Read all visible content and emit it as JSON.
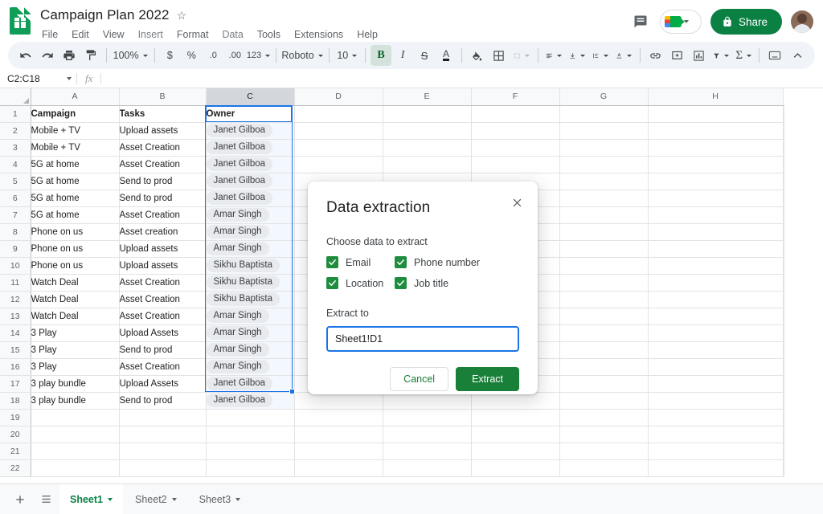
{
  "app": {
    "logo_icon": "sheets-logo-icon",
    "doc_title": "Campaign Plan 2022",
    "star_icon": "☆",
    "menus": [
      "File",
      "Edit",
      "View",
      "Insert",
      "Format",
      "Data",
      "Tools",
      "Extensions",
      "Help"
    ],
    "comment_icon": "comment-icon",
    "meet_icon": "meet-camera-icon",
    "share_label": "Share",
    "share_lock_icon": "lock-icon",
    "avatar_icon": "user-avatar",
    "accent_green": "#0b8043",
    "accent_blue": "#1a73e8"
  },
  "toolbar": {
    "undo": "undo-icon",
    "redo": "redo-icon",
    "print": "print-icon",
    "paint": "paint-format-icon",
    "zoom_value": "100%",
    "currency": "$",
    "percent": "%",
    "decimal_decrease": ".0",
    "decimal_increase": ".00",
    "number_format": "123",
    "font_name": "Roboto",
    "font_size": "10",
    "bold": "B",
    "italic": "I",
    "strikethrough": "S",
    "text_color": "A",
    "fill_color": "fill-color-icon",
    "borders": "borders-icon",
    "merge_cells": "merge-cells-icon",
    "align_horizontal": "align-left-icon",
    "align_vertical": "align-bottom-icon",
    "text_wrap": "text-wrap-icon",
    "text_rotation": "text-rotation-icon",
    "insert_link": "link-icon",
    "insert_comment": "comment-plus-icon",
    "insert_chart": "chart-icon",
    "filter": "filter-icon",
    "functions": "sigma-icon",
    "input_tools": "input-tools-icon",
    "collapse": "collapse-chevron-icon"
  },
  "formula_bar": {
    "name_box": "C2:C18",
    "fx_label": "fx",
    "formula_value": ""
  },
  "grid": {
    "columns": [
      "A",
      "B",
      "C",
      "D",
      "E",
      "F",
      "G",
      "H"
    ],
    "selected_column": "C",
    "header_row": [
      "Campaign",
      "Tasks",
      "Owner"
    ],
    "rows": [
      {
        "n": 2,
        "campaign": "Mobile + TV",
        "task": "Upload assets",
        "owner": "Janet Gilboa"
      },
      {
        "n": 3,
        "campaign": "Mobile + TV",
        "task": "Asset Creation",
        "owner": "Janet Gilboa"
      },
      {
        "n": 4,
        "campaign": "5G at home",
        "task": "Asset Creation",
        "owner": "Janet Gilboa"
      },
      {
        "n": 5,
        "campaign": "5G at home",
        "task": "Send to prod",
        "owner": "Janet Gilboa"
      },
      {
        "n": 6,
        "campaign": "5G at home",
        "task": "Send to prod",
        "owner": "Janet Gilboa"
      },
      {
        "n": 7,
        "campaign": "5G at home",
        "task": "Asset Creation",
        "owner": "Amar Singh"
      },
      {
        "n": 8,
        "campaign": "Phone on us",
        "task": "Asset creation",
        "owner": "Amar Singh"
      },
      {
        "n": 9,
        "campaign": "Phone on us",
        "task": "Upload assets",
        "owner": "Amar Singh"
      },
      {
        "n": 10,
        "campaign": "Phone on us",
        "task": "Upload assets",
        "owner": "Sikhu Baptista"
      },
      {
        "n": 11,
        "campaign": "Watch Deal",
        "task": "Asset Creation",
        "owner": "Sikhu Baptista"
      },
      {
        "n": 12,
        "campaign": "Watch Deal",
        "task": "Asset Creation",
        "owner": "Sikhu Baptista"
      },
      {
        "n": 13,
        "campaign": "Watch Deal",
        "task": "Asset Creation",
        "owner": "Amar Singh"
      },
      {
        "n": 14,
        "campaign": "3 Play",
        "task": "Upload Assets",
        "owner": "Amar Singh"
      },
      {
        "n": 15,
        "campaign": "3 Play",
        "task": "Send to prod",
        "owner": "Amar Singh"
      },
      {
        "n": 16,
        "campaign": "3 Play",
        "task": "Asset Creation",
        "owner": "Amar Singh"
      },
      {
        "n": 17,
        "campaign": "3 play bundle",
        "task": "Upload Assets",
        "owner": "Janet Gilboa"
      },
      {
        "n": 18,
        "campaign": "3 play bundle",
        "task": "Send to prod",
        "owner": "Janet Gilboa"
      }
    ],
    "empty_rows": [
      19,
      20,
      21,
      22
    ]
  },
  "dialog": {
    "title": "Data extraction",
    "close_icon": "close-icon",
    "subtitle": "Choose data to extract",
    "options": [
      {
        "label": "Email",
        "checked": true
      },
      {
        "label": "Phone number",
        "checked": true
      },
      {
        "label": "Location",
        "checked": true
      },
      {
        "label": "Job title",
        "checked": true
      }
    ],
    "extract_to_label": "Extract to",
    "range_value": "Sheet1!D1",
    "cancel_label": "Cancel",
    "extract_label": "Extract"
  },
  "sheetbar": {
    "add_icon": "add-sheet-icon",
    "list_icon": "all-sheets-icon",
    "tabs": [
      {
        "label": "Sheet1",
        "active": true
      },
      {
        "label": "Sheet2",
        "active": false
      },
      {
        "label": "Sheet3",
        "active": false
      }
    ]
  }
}
